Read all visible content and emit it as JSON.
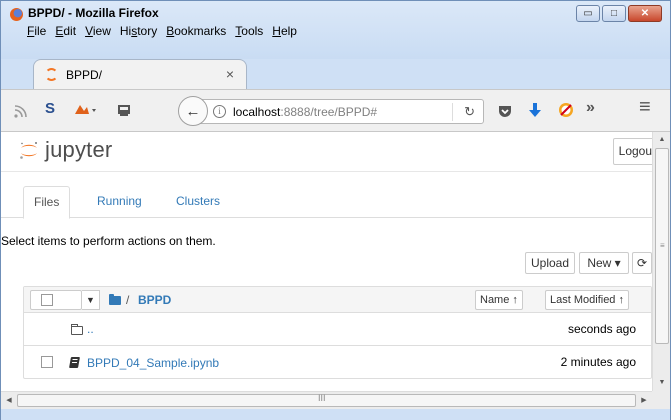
{
  "window": {
    "title": "BPPD/ - Mozilla Firefox",
    "minimize": "▭",
    "maximize": "□",
    "close": "✕"
  },
  "menu": [
    "File",
    "Edit",
    "View",
    "History",
    "Bookmarks",
    "Tools",
    "Help"
  ],
  "menu_underlines": [
    "F",
    "E",
    "V",
    "s",
    "B",
    "T",
    "H"
  ],
  "browser_tab": {
    "title": "BPPD/",
    "close": "×"
  },
  "navbar": {
    "url_host": "localhost",
    "url_rest": ":8888/tree/BPPD#",
    "info": "i",
    "reload": "↻",
    "overflow": "»",
    "menu": "≡",
    "back": "←"
  },
  "jupyter": {
    "logo_text": "jupyter",
    "logout_label": "Logout",
    "tabs": [
      "Files",
      "Running",
      "Clusters"
    ],
    "hint": "Select items to perform actions on them.",
    "upload_label": "Upload",
    "new_label": "New ▾",
    "refresh_label": "⟳",
    "breadcrumb_sep": "/",
    "breadcrumb_folder": "BPPD",
    "sort_name": "Name ↑",
    "sort_modified": "Last Modified ↑",
    "items": [
      {
        "name": "..",
        "time": "seconds ago"
      },
      {
        "name": "BPPD_04_Sample.ipynb",
        "time": "2 minutes ago"
      }
    ]
  },
  "scrollbar": {
    "up": "▲",
    "down": "▼",
    "left": "◀",
    "right": "▶",
    "vgrip": "≡",
    "hgrip": "III"
  },
  "colors": {
    "link": "#337ab7",
    "jupyter_orange": "#f37726",
    "titlebar": "#cfe0f5"
  }
}
